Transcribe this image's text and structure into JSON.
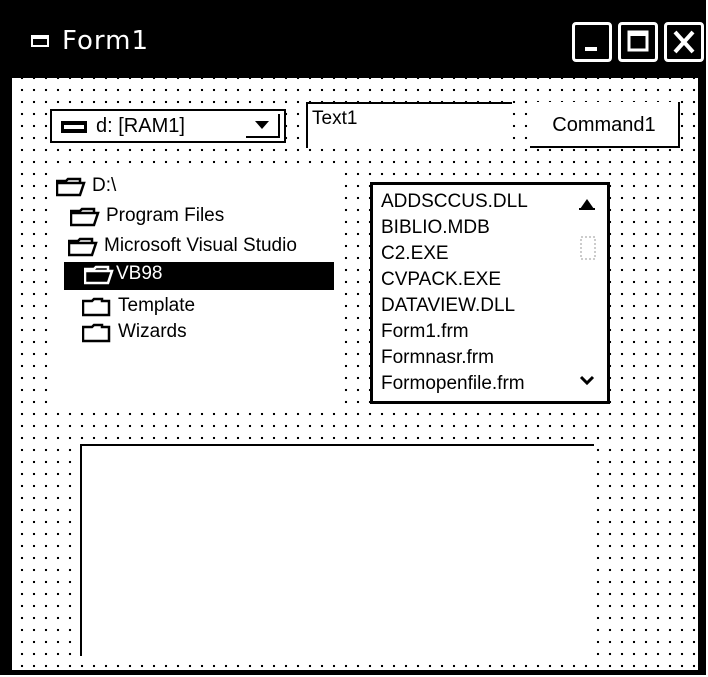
{
  "window": {
    "title": "Form1",
    "title_icon": "form-icon",
    "controls": [
      "minimize-icon",
      "maximize-icon",
      "close-icon"
    ]
  },
  "drive_combo": {
    "value": "d: [RAM1]",
    "icon": "drive-icon"
  },
  "text_box": {
    "value": "Text1"
  },
  "command_button": {
    "label": "Command1"
  },
  "dir_list": {
    "items": [
      {
        "label": "D:\\",
        "icon": "open-folder-icon",
        "selected": false
      },
      {
        "label": "Program Files",
        "icon": "open-folder-icon",
        "selected": false
      },
      {
        "label": "Microsoft Visual Studio",
        "icon": "open-folder-icon",
        "selected": false
      },
      {
        "label": "VB98",
        "icon": "open-folder-icon",
        "selected": true
      },
      {
        "label": "Template",
        "icon": "folder-icon",
        "selected": false
      },
      {
        "label": "Wizards",
        "icon": "folder-icon",
        "selected": false
      }
    ]
  },
  "file_list": {
    "items": [
      "ADDSCCUS.DLL",
      "BIBLIO.MDB",
      "C2.EXE",
      "CVPACK.EXE",
      "DATAVIEW.DLL",
      "Form1.frm",
      "Formnasr.frm",
      "Formopenfile.frm"
    ]
  },
  "picture_box": {}
}
